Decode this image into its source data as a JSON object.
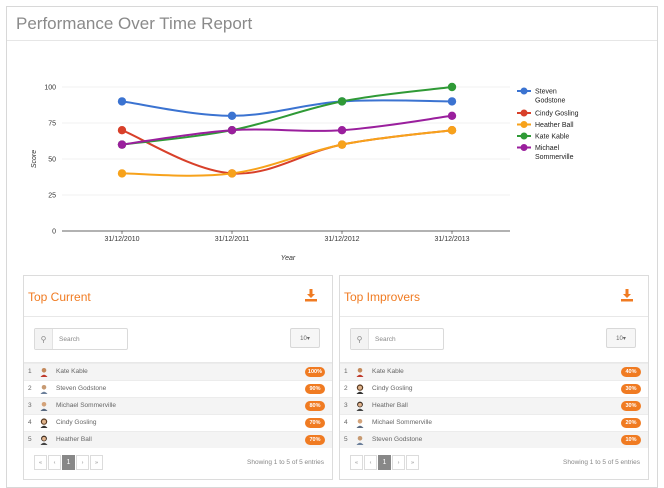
{
  "report": {
    "title": "Performance Over Time Report"
  },
  "chart_data": {
    "type": "line",
    "categories": [
      "31/12/2010",
      "31/12/2011",
      "31/12/2012",
      "31/12/2013"
    ],
    "xlabel": "Year",
    "ylabel": "Score",
    "ylim": [
      0,
      100
    ],
    "yticks": [
      "0",
      "25",
      "50",
      "75",
      "100"
    ],
    "legend_position": "right",
    "series": [
      {
        "name": "Steven Godstone",
        "color": "#3b73d1",
        "values": [
          90,
          80,
          90,
          90
        ]
      },
      {
        "name": "Cindy Gosling",
        "color": "#d8402a",
        "values": [
          70,
          40,
          60,
          70
        ]
      },
      {
        "name": "Heather Ball",
        "color": "#f7a21b",
        "values": [
          40,
          40,
          60,
          70
        ]
      },
      {
        "name": "Kate Kable",
        "color": "#2f9a36",
        "values": [
          60,
          70,
          90,
          100
        ]
      },
      {
        "name": "Michael Sommerville",
        "color": "#9a1f9d",
        "values": [
          60,
          70,
          70,
          80
        ]
      }
    ]
  },
  "top_current": {
    "title": "Top Current",
    "search_placeholder": "Search",
    "page_size": "10▾",
    "rows": [
      {
        "rank": "1",
        "name": "Kate Kable",
        "badge": "100%"
      },
      {
        "rank": "2",
        "name": "Steven Godstone",
        "badge": "90%"
      },
      {
        "rank": "3",
        "name": "Michael Sommerville",
        "badge": "80%"
      },
      {
        "rank": "4",
        "name": "Cindy Gosling",
        "badge": "70%"
      },
      {
        "rank": "5",
        "name": "Heather Ball",
        "badge": "70%"
      }
    ],
    "pager": {
      "first": "«",
      "prev": "‹",
      "current": "1",
      "next": "›",
      "last": "»"
    },
    "info": "Showing 1 to 5 of 5 entries"
  },
  "top_improvers": {
    "title": "Top Improvers",
    "search_placeholder": "Search",
    "page_size": "10▾",
    "rows": [
      {
        "rank": "1",
        "name": "Kate Kable",
        "badge": "40%"
      },
      {
        "rank": "2",
        "name": "Cindy Gosling",
        "badge": "30%"
      },
      {
        "rank": "3",
        "name": "Heather Ball",
        "badge": "30%"
      },
      {
        "rank": "4",
        "name": "Michael Sommerville",
        "badge": "20%"
      },
      {
        "rank": "5",
        "name": "Steven Godstone",
        "badge": "10%"
      }
    ],
    "pager": {
      "first": "«",
      "prev": "‹",
      "current": "1",
      "next": "›",
      "last": "»"
    },
    "info": "Showing 1 to 5 of 5 entries"
  },
  "colors": {
    "accent": "#f07b22",
    "panel_border": "#dcdcdc"
  },
  "icons": {
    "download": "download-icon",
    "search": "search-icon",
    "avatar": "avatar-icon"
  }
}
